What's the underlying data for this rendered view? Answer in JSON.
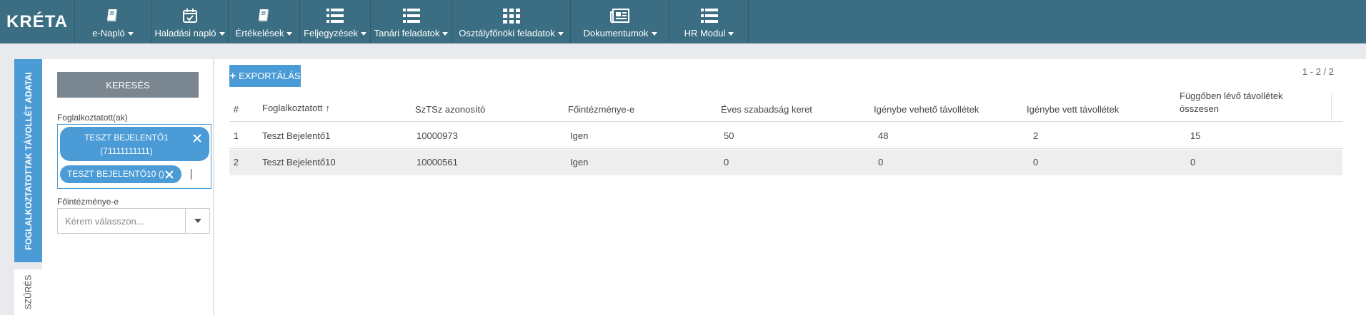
{
  "app": {
    "logo": "KRÉTA"
  },
  "nav": {
    "items": [
      {
        "label": "e-Napló",
        "icon": "book-icon"
      },
      {
        "label": "Haladási napló",
        "icon": "calendar-check-icon"
      },
      {
        "label": "Értékelések",
        "icon": "book-icon"
      },
      {
        "label": "Feljegyzések",
        "icon": "list-icon"
      },
      {
        "label": "Tanári feladatok",
        "icon": "list-icon"
      },
      {
        "label": "Osztályfőnöki feladatok",
        "icon": "grid-icon"
      },
      {
        "label": "Dokumentumok",
        "icon": "newspaper-icon"
      },
      {
        "label": "HR Modul",
        "icon": "list-icon"
      }
    ]
  },
  "side_tabs": {
    "active": "FOGLALKOZTATOTTAK TÁVOLLÉT ADATAI",
    "inactive": "SZŰRÉS"
  },
  "search": {
    "button_label": "KERESÉS",
    "employees_label": "Foglalkoztatott(ak)",
    "selected_tags": [
      {
        "line1": "TESZT BEJELENTŐ1",
        "line2": "(71111111111)"
      },
      {
        "line1": "TESZT BEJELENTŐ10 ()"
      }
    ],
    "main_institution_label": "Főintézménye-e",
    "main_institution_placeholder": "Kérem válasszon..."
  },
  "results": {
    "export_label": "EXPORTÁLÁS",
    "pager_info": "1 - 2 / 2",
    "columns": [
      "#",
      "Foglalkoztatott",
      "SzTSz azonosító",
      "Főintézménye-e",
      "Éves szabadság keret",
      "Igénybe vehető távollétek",
      "Igénybe vett távollétek",
      "Függőben lévő távollétek összesen"
    ],
    "sort_indicator": "↑",
    "rows": [
      {
        "idx": "1",
        "name": "Teszt Bejelentő1",
        "sztsz": "10000973",
        "main": "Igen",
        "annual": "50",
        "available": "48",
        "used": "2",
        "pending": "15"
      },
      {
        "idx": "2",
        "name": "Teszt Bejelentő10",
        "sztsz": "10000561",
        "main": "Igen",
        "annual": "0",
        "available": "0",
        "used": "0",
        "pending": "0"
      }
    ]
  }
}
